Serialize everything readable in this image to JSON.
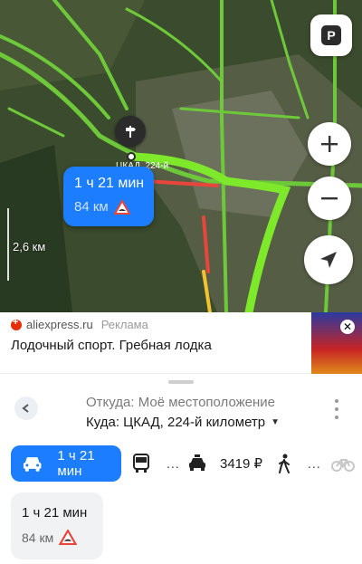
{
  "map": {
    "route_bubble": {
      "time": "1 ч 21 мин",
      "distance": "84 км"
    },
    "road_label": "ЦКАД, 224-й",
    "scale": "2,6 км",
    "parking_label": "P"
  },
  "ad": {
    "source": "aliexpress.ru",
    "badge": "Реклама",
    "title": "Лодочный спорт. Гребная лодка",
    "close": "✕"
  },
  "route": {
    "from": "Откуда: Моё местоположение",
    "to": "Куда: ЦКАД, 224-й километр",
    "to_caret": "▼"
  },
  "modes": {
    "car": {
      "label": "1 ч 21 мин",
      "icon": "car-icon"
    },
    "bus": {
      "label": "...",
      "icon": "bus-icon"
    },
    "taxi": {
      "label": "3419 ₽",
      "icon": "taxi-icon"
    },
    "walk": {
      "label": "...",
      "icon": "pedestrian-icon"
    },
    "bike": {
      "icon": "bicycle-icon"
    }
  },
  "summary": {
    "time": "1 ч 21 мин",
    "distance": "84 км"
  },
  "colors": {
    "accent": "#1c7dff",
    "route_green": "#7ee82a",
    "traffic_red": "#e8463b"
  }
}
